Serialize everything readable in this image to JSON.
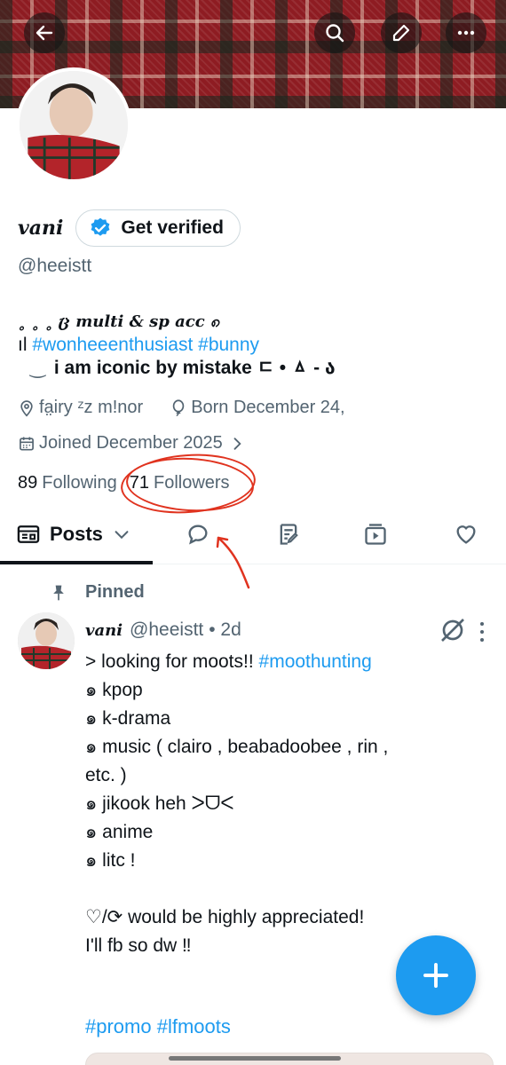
{
  "header": {
    "back_icon": "arrow-left-icon",
    "search_icon": "search-icon",
    "edit_icon": "pencil-icon",
    "more_icon": "more-horizontal-icon"
  },
  "profile": {
    "display_name": "vani",
    "verify_label": "Get verified",
    "handle": "@heeistt",
    "bio": {
      "line1": "˳ ˳ ˳ ც multi & sp acc ၈",
      "line2_prefix": "ıl ",
      "line2_tags": "#wonheeenthusiast #bunny",
      "line3": "i am iconic by mistake ㄷ • ㅿ - ა",
      "line3_prefix": "‿"
    },
    "location": "fa̤iry  ᶻz  m!nor",
    "birthday": "Born December 24,",
    "joined": "Joined December 2025",
    "following_count": "89",
    "following_label": "Following",
    "followers_count": "71",
    "followers_label": "Followers"
  },
  "tabs": {
    "posts_label": "Posts",
    "icons": [
      "list-icon",
      "reply-icon",
      "article-icon",
      "media-icon",
      "like-icon"
    ]
  },
  "post": {
    "pinned_label": "Pinned",
    "author_name": "vani",
    "author_handle": "@heeistt",
    "time": "• 2d",
    "text_prefix": "> looking for moots!! ",
    "text_tag": "#moothunting",
    "body": "\n๑ kpop\n๑ k-drama\n๑ music ( clairo , beabadoobee , rin ,\netc. )\n๑ jikook heh ᐳᗜᐸ\n๑ anime\n๑ litc !\n\n♡/⟳ would be highly appreciated!\nI'll fb so dw ‼",
    "tags": "#promo #lfmoots"
  },
  "colors": {
    "accent": "#1d9bf0",
    "annotation": "#e0331f",
    "muted": "#536471"
  }
}
